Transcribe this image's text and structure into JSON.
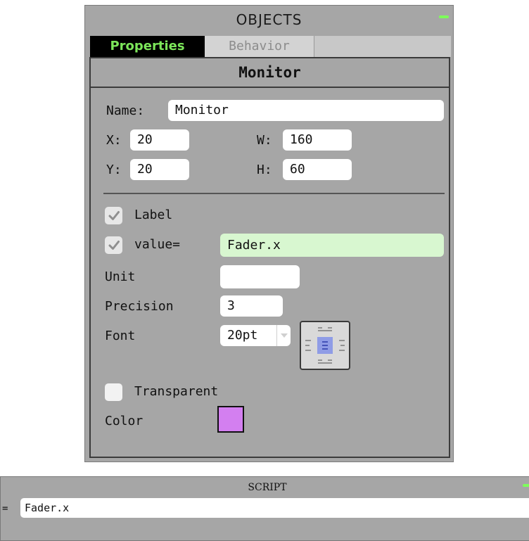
{
  "objects_panel": {
    "title": "OBJECTS",
    "tabs": [
      {
        "label": "Properties",
        "active": true
      },
      {
        "label": "Behavior",
        "active": false
      }
    ],
    "object_name": "Monitor",
    "name_label": "Name:",
    "name_value": "Monitor",
    "x_label": "X:",
    "x_value": "20",
    "y_label": "Y:",
    "y_value": "20",
    "w_label": "W:",
    "w_value": "160",
    "h_label": "H:",
    "h_value": "60",
    "label_checkbox": {
      "label": "Label",
      "checked": true
    },
    "value_checkbox": {
      "label": "value=",
      "checked": true,
      "expression": "Fader.x"
    },
    "unit_label": "Unit",
    "unit_value": "",
    "precision_label": "Precision",
    "precision_value": "3",
    "font_label": "Font",
    "font_value": "20pt",
    "transparent_checkbox": {
      "label": "Transparent",
      "checked": false
    },
    "color_label": "Color",
    "color_value": "#d37ff0",
    "accent_green": "#7ce65a",
    "icons": [
      "minimize-icon",
      "checkmark-icon",
      "dropdown-arrow-icon",
      "align-center-icon"
    ]
  },
  "script_panel": {
    "title": "SCRIPT",
    "prefix": "=",
    "value": "Fader.x"
  }
}
